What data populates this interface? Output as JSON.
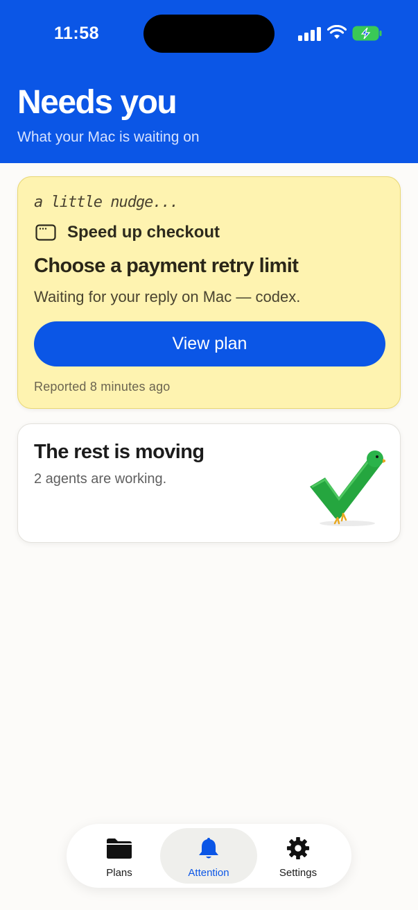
{
  "status_bar": {
    "time": "11:58"
  },
  "header": {
    "title": "Needs you",
    "subtitle": "What your Mac is waiting on"
  },
  "nudge_card": {
    "label": "a little nudge...",
    "plan_name": "Speed up checkout",
    "plan_icon": "window-icon",
    "title": "Choose a payment retry limit",
    "description": "Waiting for your reply on Mac — codex.",
    "button_label": "View plan",
    "reported": "Reported 8 minutes ago"
  },
  "rest_card": {
    "title": "The rest is moving",
    "subtitle": "2 agents are working.",
    "icon": "bird-check-icon"
  },
  "tab_bar": {
    "tabs": [
      {
        "label": "Plans",
        "icon": "folder-icon",
        "active": false
      },
      {
        "label": "Attention",
        "icon": "bell-icon",
        "active": true
      },
      {
        "label": "Settings",
        "icon": "gear-icon",
        "active": false
      }
    ]
  },
  "colors": {
    "brand_blue": "#0b56e6",
    "nudge_yellow": "#fef3b0",
    "check_green": "#2bb34a"
  }
}
